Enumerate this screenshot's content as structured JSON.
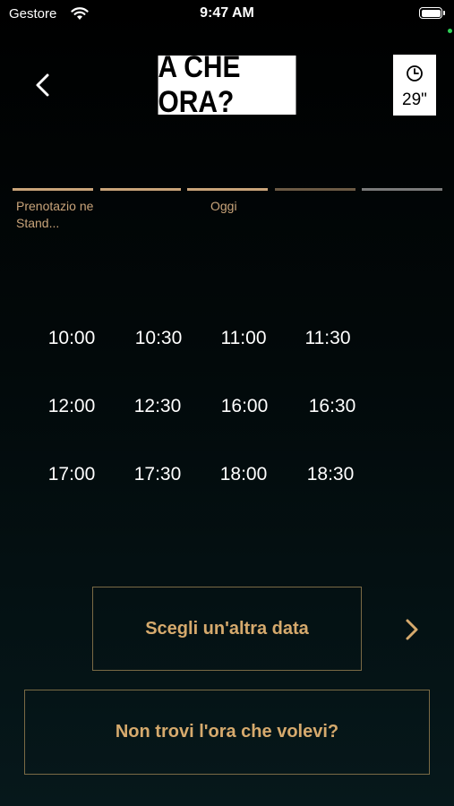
{
  "status_bar": {
    "carrier": "Gestore",
    "time": "9:47 AM"
  },
  "header": {
    "title": "A CHE ORA?",
    "timer": "29\""
  },
  "steps": [
    {
      "label": "Prenotazio ne Stand...",
      "color": "#c9a47a"
    },
    {
      "label": "",
      "color": "#c9a47a"
    },
    {
      "label": "Oggi",
      "color": "#c9a47a"
    },
    {
      "label": "",
      "color": "#6b5a45"
    },
    {
      "label": "",
      "color": "#7a7a7a"
    }
  ],
  "times": [
    [
      "10:00",
      "10:30",
      "11:00",
      "11:30"
    ],
    [
      "12:00",
      "12:30",
      "16:00",
      "16:30"
    ],
    [
      "17:00",
      "17:30",
      "18:00",
      "18:30"
    ]
  ],
  "buttons": {
    "other_date": "Scegli un'altra data",
    "not_found": "Non trovi l'ora che volevi?"
  },
  "colors": {
    "accent": "#d6aa6d",
    "border": "#7a6a45"
  }
}
